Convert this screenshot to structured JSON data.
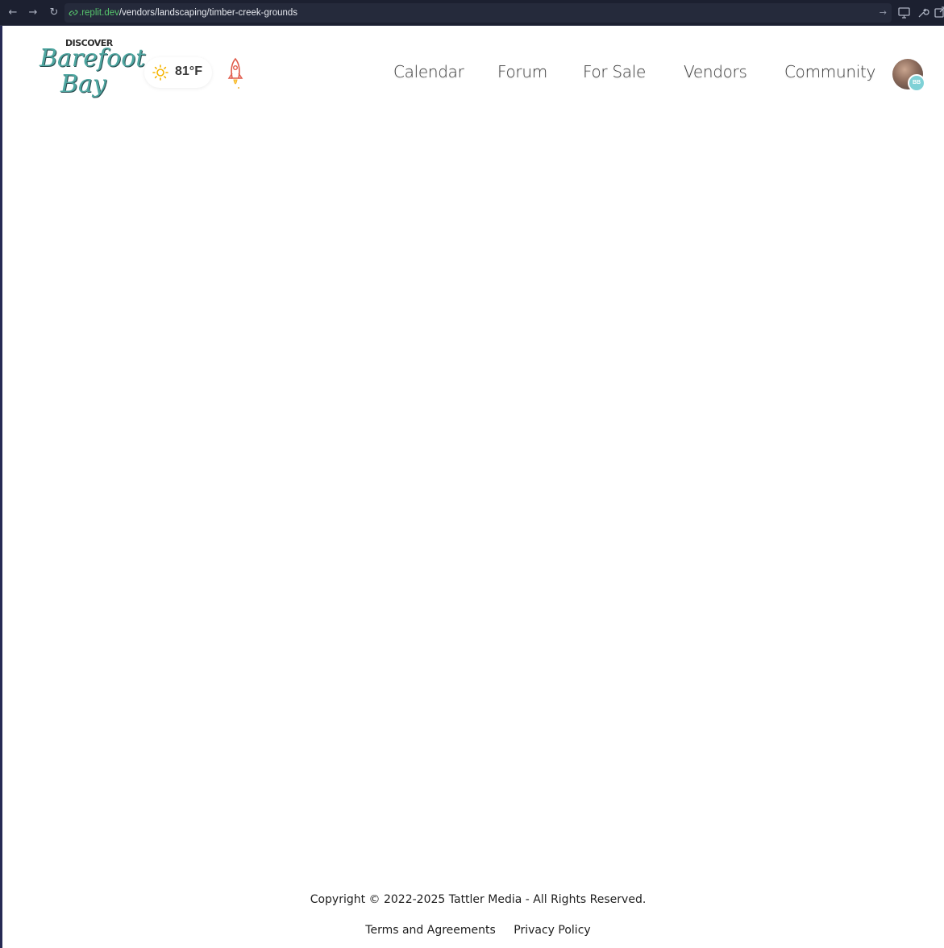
{
  "browser": {
    "back_icon": "arrow-left-icon",
    "forward_icon": "arrow-right-icon",
    "reload_icon": "reload-icon",
    "url_domain": ".replit.dev",
    "url_path": "/vendors/landscaping/timber-creek-grounds",
    "accent": "#56c46c"
  },
  "header": {
    "logo": {
      "top": "DISCOVER",
      "line1": "Barefoot",
      "line2": "Bay"
    },
    "weather": {
      "icon": "sun-icon",
      "temperature": "81°F"
    },
    "rocket_icon": "rocket-icon",
    "nav": [
      {
        "label": "Calendar"
      },
      {
        "label": "Forum"
      },
      {
        "label": "For Sale"
      },
      {
        "label": "Vendors"
      },
      {
        "label": "Community"
      }
    ],
    "avatar": {
      "badge": "BB",
      "badge_color": "#7fd1d6"
    }
  },
  "footer": {
    "copyright": "Copyright © 2022-2025 Tattler Media - All Rights Reserved.",
    "links": [
      {
        "label": "Terms and Agreements"
      },
      {
        "label": "Privacy Policy"
      }
    ]
  }
}
